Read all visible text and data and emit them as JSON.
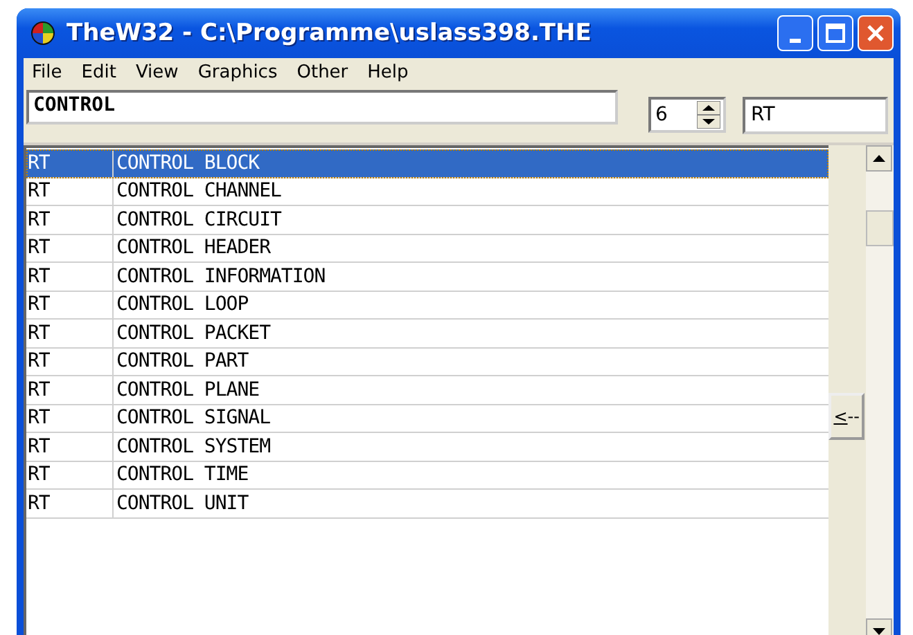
{
  "window": {
    "title": "TheW32 - C:\\Programme\\uslass398.THE"
  },
  "menu": [
    "File",
    "Edit",
    "View",
    "Graphics",
    "Other",
    "Help"
  ],
  "search": {
    "value": "CONTROL"
  },
  "spinner": {
    "value": "6"
  },
  "filter": {
    "value": "RT"
  },
  "list": {
    "rows": [
      {
        "code": "RT",
        "term": "CONTROL BLOCK",
        "selected": true
      },
      {
        "code": "RT",
        "term": "CONTROL CHANNEL",
        "selected": false
      },
      {
        "code": "RT",
        "term": "CONTROL CIRCUIT",
        "selected": false
      },
      {
        "code": "RT",
        "term": "CONTROL HEADER",
        "selected": false
      },
      {
        "code": "RT",
        "term": "CONTROL INFORMATION",
        "selected": false
      },
      {
        "code": "RT",
        "term": "CONTROL LOOP",
        "selected": false
      },
      {
        "code": "RT",
        "term": "CONTROL PACKET",
        "selected": false
      },
      {
        "code": "RT",
        "term": "CONTROL PART",
        "selected": false
      },
      {
        "code": "RT",
        "term": "CONTROL PLANE",
        "selected": false
      },
      {
        "code": "RT",
        "term": "CONTROL SIGNAL",
        "selected": false
      },
      {
        "code": "RT",
        "term": "CONTROL SYSTEM",
        "selected": false
      },
      {
        "code": "RT",
        "term": "CONTROL TIME",
        "selected": false
      },
      {
        "code": "RT",
        "term": "CONTROL UNIT",
        "selected": false
      }
    ]
  },
  "back_button": {
    "label": "<--"
  }
}
